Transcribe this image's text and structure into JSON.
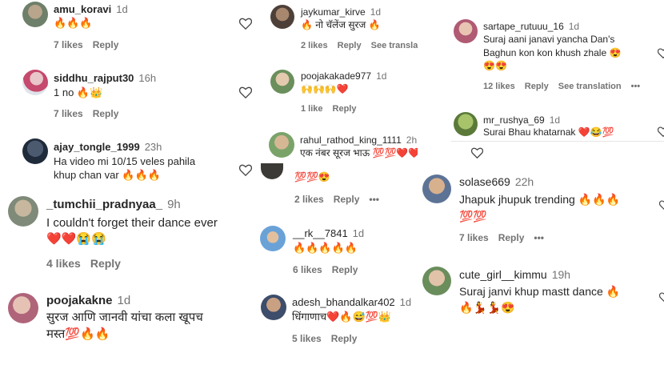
{
  "labels": {
    "likes_suffix": "likes",
    "reply": "Reply",
    "see_translation": "See translation",
    "more": "•••"
  },
  "col1": [
    {
      "user": "amu_koravi",
      "time": "1d",
      "text": "🔥🔥🔥",
      "likes": "7 likes"
    },
    {
      "user": "siddhu_rajput30",
      "time": "16h",
      "text": "1 no 🔥👑",
      "likes": "7 likes"
    },
    {
      "user": "ajay_tongle_1999",
      "time": "23h",
      "text_line1": "Ha video mi 10/15 veles pahila",
      "text_line2": "khup chan var 🔥🔥🔥"
    },
    {
      "user": "_tumchii_pradnyaa_",
      "time": "9h",
      "text_line1": "I couldn't forget their dance ever",
      "text_line2": "❤️❤️😭😭",
      "likes": "4 likes"
    },
    {
      "user": "poojakakne",
      "time": "1d",
      "text_line1": "सुरज आणि जानवी यांचा कला खूपच",
      "text_line2": "मस्त💯🔥🔥"
    }
  ],
  "col2": [
    {
      "user": "jaykumar_kirve",
      "time": "1d",
      "text": "🔥 नो चॅलेंज सुरज 🔥",
      "likes": "2 likes"
    },
    {
      "user": "poojakakade977",
      "time": "1d",
      "text": "🙌🙌🙌❤️",
      "likes": "1 like"
    },
    {
      "user": "rahul_rathod_king_1111",
      "time": "2h",
      "text": "एक नंबर सूरज भाऊ 💯💯❤️❤️"
    },
    {
      "text": "💯💯😍",
      "likes": "2 likes"
    },
    {
      "user": "__rk__7841",
      "time": "1d",
      "text": "🔥🔥🔥🔥🔥",
      "likes": "6 likes"
    },
    {
      "user": "adesh_bhandalkar402",
      "time": "1d",
      "text": "धिंगाणाच❤️🔥😅💯👑",
      "likes": "5 likes"
    }
  ],
  "col3": [
    {
      "user": "sartape_rutuuu_16",
      "time": "1d",
      "text_line1": "Suraj aani janavi yancha Dan's",
      "text_line2": "Baghun kon kon khush zhale 😍",
      "text_line3": "😍😍",
      "likes": "12 likes"
    },
    {
      "user": "mr_rushya_69",
      "time": "1d",
      "text": "Surai Bhau khatarnak ❤️😂💯"
    },
    {
      "user": "solase669",
      "time": "22h",
      "text_line1": "Jhapuk jhupuk trending 🔥🔥🔥",
      "text_line2": "💯💯",
      "likes": "7 likes"
    },
    {
      "user": "cute_girl__kimmu",
      "time": "19h",
      "text_line1": "Suraj janvi khup mastt dance 🔥",
      "text_line2": "🔥💃💃😍"
    }
  ]
}
